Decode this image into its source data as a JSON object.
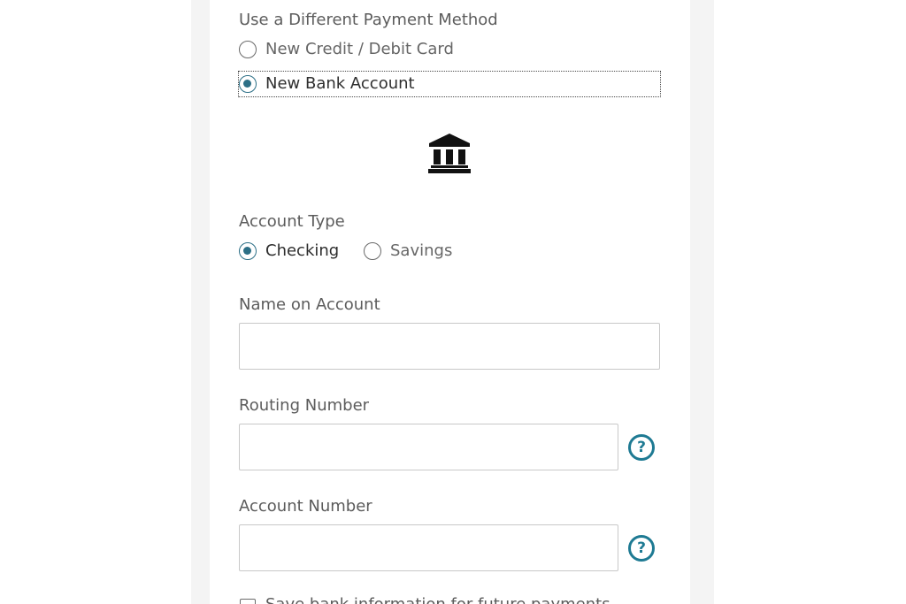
{
  "payment_method": {
    "heading": "Use a Different Payment Method",
    "options": [
      {
        "label": "New Credit / Debit Card",
        "selected": false
      },
      {
        "label": "New Bank Account",
        "selected": true
      }
    ]
  },
  "bank_icon": "bank-building-icon",
  "account_type": {
    "heading": "Account Type",
    "options": [
      {
        "label": "Checking",
        "selected": true
      },
      {
        "label": "Savings",
        "selected": false
      }
    ]
  },
  "fields": {
    "name_on_account": {
      "label": "Name on Account",
      "value": ""
    },
    "routing_number": {
      "label": "Routing Number",
      "value": "",
      "help": "?"
    },
    "account_number": {
      "label": "Account Number",
      "value": "",
      "help": "?"
    }
  },
  "save_info": {
    "label": "Save bank information for future payments",
    "checked": false
  },
  "colors": {
    "accent": "#1e7a93",
    "gutter": "#f4f4f4"
  }
}
